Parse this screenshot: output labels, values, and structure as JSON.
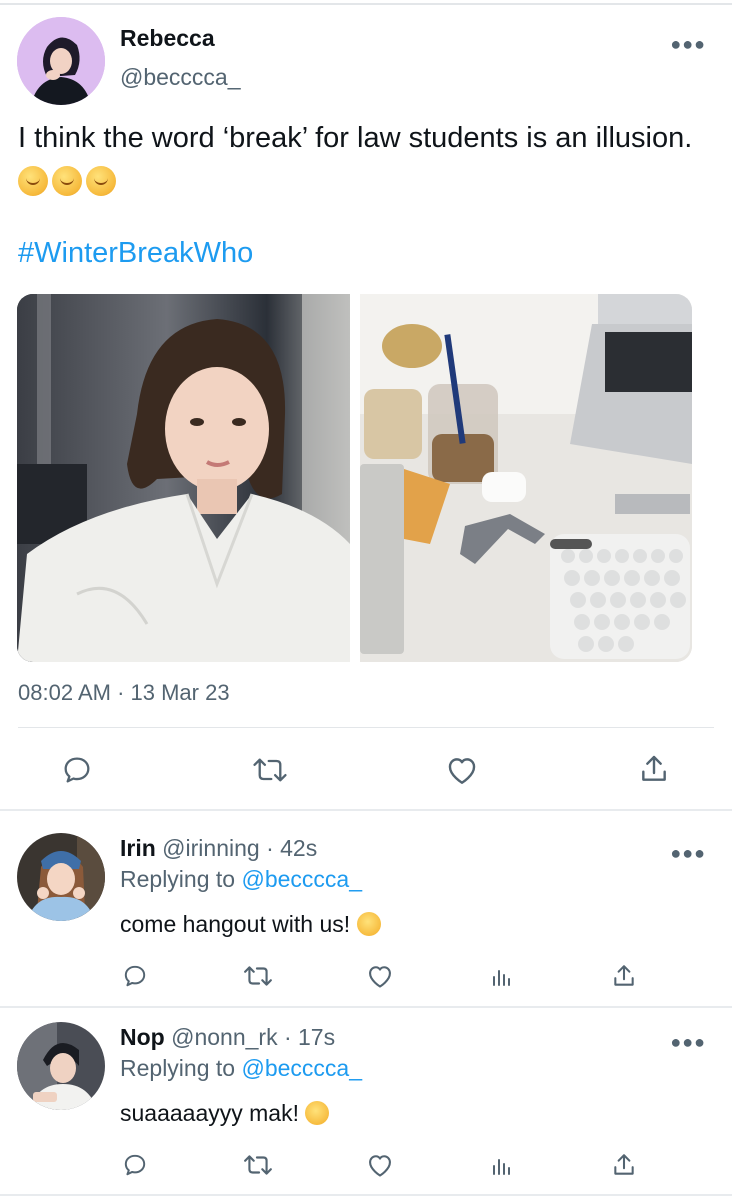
{
  "colors": {
    "link": "#1d9bf0",
    "secondary_text": "#536471",
    "primary_text": "#0f1419",
    "divider": "#e3e6e9"
  },
  "main_tweet": {
    "display_name": "Rebecca",
    "handle": "@becccca_",
    "more_icon": "more-horizontal-icon",
    "text": "I think the word ‘break’ for law students is an illusion.",
    "emojis": [
      "melting-face",
      "melting-face",
      "melting-face"
    ],
    "hashtag": "#WinterBreakWho",
    "images": [
      {
        "description_icon": "photo-portrait"
      },
      {
        "description_icon": "photo-desk"
      }
    ],
    "timestamp": "08:02 AM · 13 Mar 23",
    "actions": [
      "reply-icon",
      "retweet-icon",
      "like-icon",
      "share-icon"
    ]
  },
  "replies": [
    {
      "display_name": "Irin",
      "handle": "@irinning",
      "time": "· 42s",
      "replying_prefix": "Replying to",
      "replying_to": "@becccca_",
      "text": "come hangout with us!",
      "emoji": "face-with-rolling-eyes",
      "actions": [
        "reply-icon",
        "retweet-icon",
        "like-icon",
        "analytics-icon",
        "share-icon"
      ]
    },
    {
      "display_name": "Nop",
      "handle": "@nonn_rk",
      "time": "· 17s",
      "replying_prefix": "Replying to",
      "replying_to": "@becccca_",
      "text": "suaaaaayyy mak!",
      "emoji": "smiling-face-with-hearts",
      "actions": [
        "reply-icon",
        "retweet-icon",
        "like-icon",
        "analytics-icon",
        "share-icon"
      ]
    }
  ]
}
